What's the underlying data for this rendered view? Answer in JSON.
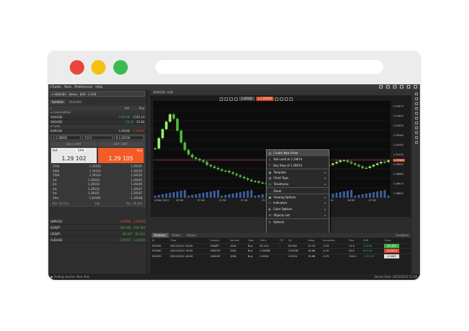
{
  "window": {
    "dots": {
      "red": "#e8453c",
      "yellow": "#f4c20d",
      "green": "#3cba54"
    }
  },
  "menu": {
    "items": [
      "cTrader",
      "Tools",
      "Preferences",
      "Help"
    ]
  },
  "account": {
    "label": "▾ 3004387 · Demo · EUR · 1:100"
  },
  "tabs": {
    "symbols": "Symbols",
    "favorites": "Favorites"
  },
  "watch_header": {
    "sell": "Sell",
    "buy": "Buy"
  },
  "groups": {
    "commodities": "▾ Commodities",
    "forex": "▾ Forex"
  },
  "commodities": [
    {
      "sym": "XAUUSD",
      "sell": "1700.88",
      "buy": "1701.13"
    },
    {
      "sym": "XAGUSD",
      "sell": "33.26",
      "buy": "33.30"
    }
  ],
  "forex_top": {
    "sym": "EURUSD",
    "sell": "1.29102",
    "buy": "1.29105"
  },
  "trade_panel": {
    "sl": "L 1.28856",
    "qty": "5 0.3",
    "tp": "H 1.29156",
    "sell_limit": "SELL LIMIT",
    "buy_limit": "BUY LIMIT",
    "sell_label": "Sell",
    "buy_label": "Buy",
    "volume": "100k",
    "sell_price": "1.29 102",
    "buy_price": "1.29 105"
  },
  "depth": [
    {
      "v": "250k",
      "s": "1.29102",
      "b": "1.29105"
    },
    {
      "v": "500k",
      "s": "1.29102",
      "b": "1.29105"
    },
    {
      "v": "750k",
      "s": "1.29102",
      "b": "1.29105"
    },
    {
      "v": "1m",
      "s": "1.29102",
      "b": "1.29105"
    },
    {
      "v": "2m",
      "s": "1.29102",
      "b": "1.29106"
    },
    {
      "v": "3m",
      "s": "1.29102",
      "b": "1.29107"
    },
    {
      "v": "5m",
      "s": "1.29101",
      "b": "1.29107"
    },
    {
      "v": "10m",
      "s": "1.29100",
      "b": "1.29108"
    }
  ],
  "spread": {
    "bid": "Bid: 29.124",
    "mid": "10k",
    "ask": "Ask: 29.42k"
  },
  "lower_rows": [
    {
      "sym": "GBPUSD",
      "sell": "1.60902",
      "buy": "1.60906",
      "color": "#e04b2a"
    },
    {
      "sym": "EURJPY",
      "sell": "106.388",
      "buy": "106.394",
      "color": "#3cb34a"
    },
    {
      "sym": "USDJPY",
      "sell": "82.407",
      "buy": "82.411",
      "color": "#3cb34a"
    },
    {
      "sym": "AUDUSD",
      "sell": "1.04067",
      "buy": "1.04069",
      "color": "#3cb34a"
    }
  ],
  "chart": {
    "tab": "EURUSD, m30",
    "timeframe": "1.29102",
    "new_order": "▾ 1.29105",
    "y_labels": [
      "1.29475",
      "1.29405",
      "1.29335",
      "1.29265",
      "1.29195",
      "1.29125",
      "1.29055",
      "1.28985",
      "1.28915",
      "1.28845"
    ],
    "current": "1.29102",
    "x_labels": [
      "6 Dec 2012",
      "02:30",
      "07:30",
      "12:30",
      "17:30",
      "22:30",
      "03:30",
      "08:30",
      "13:30",
      "18:30",
      "07:30"
    ]
  },
  "chart_data": {
    "type": "candlestick",
    "series_y_range": [
      1.2885,
      1.295
    ],
    "close": [
      1.2918,
      1.2925,
      1.2931,
      1.2936,
      1.2941,
      1.2938,
      1.293,
      1.2922,
      1.2917,
      1.2914,
      1.2912,
      1.2911,
      1.291,
      1.2909,
      1.2907,
      1.2906,
      1.2905,
      1.2904,
      1.2903,
      1.2903,
      1.2902,
      1.2901,
      1.29,
      1.2899,
      1.2898,
      1.2897,
      1.2896,
      1.2896,
      1.2895,
      1.2895,
      1.2894,
      1.2893,
      1.2893,
      1.2892,
      1.2893,
      1.2894,
      1.2895,
      1.2896,
      1.2897,
      1.2898,
      1.2898,
      1.29,
      1.2901,
      1.2902,
      1.2904,
      1.2905,
      1.2906,
      1.2907,
      1.2908,
      1.2909,
      1.291,
      1.291,
      1.2909,
      1.2908,
      1.2907,
      1.2906,
      1.2905,
      1.2905,
      1.2906,
      1.2907,
      1.2908,
      1.2909,
      1.2909,
      1.291
    ]
  },
  "context_menu": [
    {
      "label": "Create New Order",
      "glyph": "▤",
      "arrow": ""
    },
    {
      "label": "Sell Limit at 1.29674",
      "glyph": "⇣",
      "arrow": ""
    },
    {
      "label": "Buy Stop at 1.29674",
      "glyph": "⇡",
      "arrow": ""
    },
    {
      "label": "Template",
      "glyph": "▦",
      "arrow": "▸",
      "sep": true
    },
    {
      "label": "Chart Type",
      "glyph": "▥",
      "arrow": "▸"
    },
    {
      "label": "Timeframe",
      "glyph": "◷",
      "arrow": "▸"
    },
    {
      "label": "Zoom",
      "glyph": "",
      "arrow": "",
      "sep": true
    },
    {
      "label": "Viewing Options",
      "glyph": "▣",
      "arrow": "▸",
      "sep": true
    },
    {
      "label": "Indicators",
      "glyph": "∿",
      "arrow": "▸"
    },
    {
      "label": "Color Options",
      "glyph": "◐",
      "arrow": "▸"
    },
    {
      "label": "Objects List",
      "glyph": "☰",
      "arrow": "▸"
    },
    {
      "label": "Refresh",
      "glyph": "↻",
      "arrow": "",
      "sep": true
    }
  ],
  "bottom": {
    "tabs": [
      "Positions",
      "Orders",
      "History"
    ],
    "feedback": "Feedback",
    "columns": [
      "ID",
      "Time",
      "Symbol",
      "Volume",
      "Type",
      "Entry",
      "T/P",
      "S/L",
      "Swap",
      "Commissi...",
      "Pips",
      "EUR",
      "Close"
    ],
    "rows": [
      {
        "id": "300181",
        "time": "05/12/2012 18:36",
        "sym": "USDJPY",
        "vol": "100k",
        "type": "Buy",
        "entry": "82.103",
        "tp": "–",
        "sl": "82.962",
        "swap": "23.29",
        "comm": "-2.29",
        "pips": "22.4",
        "eur": "318.68",
        "close": "82.407",
        "color": "#3cb34a"
      },
      {
        "id": "300180",
        "time": "05/12/2012 18:36",
        "sym": "USDCHF",
        "vol": "100k",
        "type": "Buy",
        "entry": "0.92668",
        "tp": "–",
        "sl": "0.92262",
        "swap": "26.66",
        "comm": "-2.29",
        "pips": "64.4",
        "eur": "655.56",
        "close": "0.93012",
        "color": "#e04b2a"
      },
      {
        "id": "300150",
        "time": "05/12/2012 18:36",
        "sym": "CADCHF",
        "vol": "100k",
        "type": "Buy",
        "entry": "0.9334",
        "tp": "–",
        "sl": "0.9324",
        "swap": "29.66",
        "comm": "-2.29",
        "pips": "133.0",
        "eur": "1 321.63",
        "close": "0.9467",
        "color": "#dddddd"
      }
    ]
  },
  "status": {
    "left": "● Trading session: New York",
    "right": "Server time: 10/12/2012 11:36"
  }
}
